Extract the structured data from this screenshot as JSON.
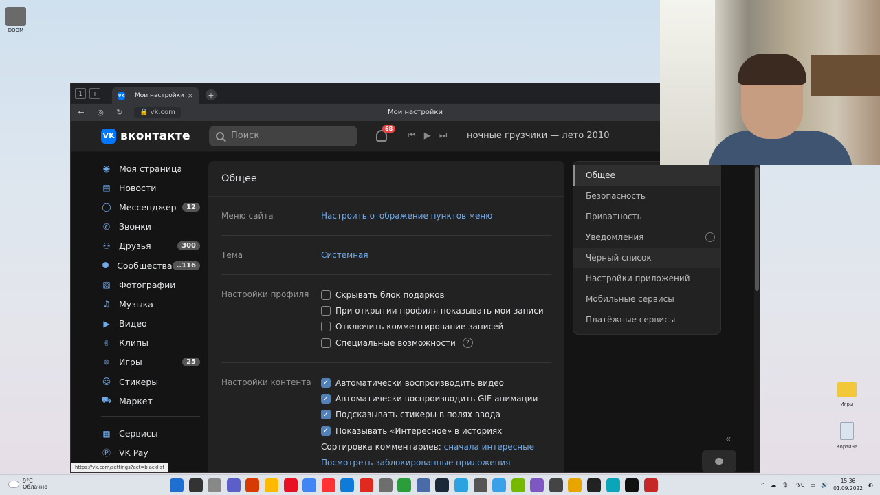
{
  "desktop": {
    "top_icon_label": "DOOM",
    "folder_label": "Игры",
    "recycle_label": "Корзина"
  },
  "browser": {
    "tab_counter": "1",
    "tab_title": "Мои настройки",
    "url": "vk.com",
    "page_title": "Мои настройки",
    "status_url": "https://vk.com/settings?act=blacklist"
  },
  "header": {
    "logo_text": "вконтакте",
    "search_placeholder": "Поиск",
    "notifications_count": "68",
    "now_playing": "ночные грузчики — лето 2010"
  },
  "sidebar": {
    "items": [
      {
        "label": "Моя страница",
        "icon": "user-circle-icon",
        "count": ""
      },
      {
        "label": "Новости",
        "icon": "news-icon",
        "count": ""
      },
      {
        "label": "Мессенджер",
        "icon": "message-icon",
        "count": "12"
      },
      {
        "label": "Звонки",
        "icon": "phone-icon",
        "count": ""
      },
      {
        "label": "Друзья",
        "icon": "friends-icon",
        "count": "300"
      },
      {
        "label": "Сообщества",
        "icon": "groups-icon",
        "count": "..116"
      },
      {
        "label": "Фотографии",
        "icon": "photo-icon",
        "count": ""
      },
      {
        "label": "Музыка",
        "icon": "music-icon",
        "count": ""
      },
      {
        "label": "Видео",
        "icon": "video-icon",
        "count": ""
      },
      {
        "label": "Клипы",
        "icon": "clips-icon",
        "count": ""
      },
      {
        "label": "Игры",
        "icon": "gamepad-icon",
        "count": "25"
      },
      {
        "label": "Стикеры",
        "icon": "sticker-icon",
        "count": ""
      },
      {
        "label": "Маркет",
        "icon": "bag-icon",
        "count": ""
      }
    ],
    "extra_items": [
      {
        "label": "Сервисы",
        "icon": "services-icon"
      },
      {
        "label": "VK Pay",
        "icon": "vkpay-icon"
      }
    ]
  },
  "settings": {
    "title": "Общее",
    "menu_label": "Меню сайта",
    "menu_link": "Настроить отображение пунктов меню",
    "theme_label": "Тема",
    "theme_value": "Системная",
    "profile_label": "Настройки профиля",
    "profile_options": [
      {
        "label": "Скрывать блок подарков",
        "checked": false
      },
      {
        "label": "При открытии профиля показывать мои записи",
        "checked": false
      },
      {
        "label": "Отключить комментирование записей",
        "checked": false
      },
      {
        "label": "Специальные возможности",
        "checked": false
      }
    ],
    "help_mark": "?",
    "content_label": "Настройки контента",
    "content_options": [
      {
        "label": "Автоматически воспроизводить видео",
        "checked": true
      },
      {
        "label": "Автоматически воспроизводить GIF-анимации",
        "checked": true
      },
      {
        "label": "Подсказывать стикеры в полях ввода",
        "checked": true
      },
      {
        "label": "Показывать «Интересное» в историях",
        "checked": true
      }
    ],
    "sort_label": "Сортировка комментариев:",
    "sort_value": "сначала интересные",
    "blocked_apps_link": "Посмотреть заблокированные приложения"
  },
  "right_menu": {
    "items": [
      {
        "label": "Общее",
        "state": "active"
      },
      {
        "label": "Безопасность",
        "state": ""
      },
      {
        "label": "Приватность",
        "state": ""
      },
      {
        "label": "Уведомления",
        "state": "gear"
      },
      {
        "label": "Чёрный список",
        "state": "hover"
      },
      {
        "label": "Настройки приложений",
        "state": ""
      },
      {
        "label": "Мобильные сервисы",
        "state": ""
      },
      {
        "label": "Платёжные сервисы",
        "state": ""
      }
    ]
  },
  "taskbar": {
    "weather_temp": "9°C",
    "weather_text": "Облачно",
    "lang": "РУС",
    "time": "15:36",
    "date": "01.09.2022",
    "app_colors": [
      "#1f6fd1",
      "#333333",
      "#888888",
      "#5b5fc7",
      "#d83b01",
      "#ffb900",
      "#e81123",
      "#4285f4",
      "#ff3333",
      "#0f7bd8",
      "#e02a20",
      "#6e6e6e",
      "#2b9d3a",
      "#4b6aa8",
      "#1b2838",
      "#2aa3e0",
      "#555555",
      "#3aa0e8",
      "#76b900",
      "#7e57c2",
      "#444444",
      "#e8a400",
      "#222222",
      "#0aa5b8",
      "#111111",
      "#c62828"
    ]
  },
  "colors": {
    "vk_blue": "#0077ff",
    "link": "#71aaeb",
    "checkbox_on": "#5181b8",
    "badge_red": "#e64646"
  }
}
